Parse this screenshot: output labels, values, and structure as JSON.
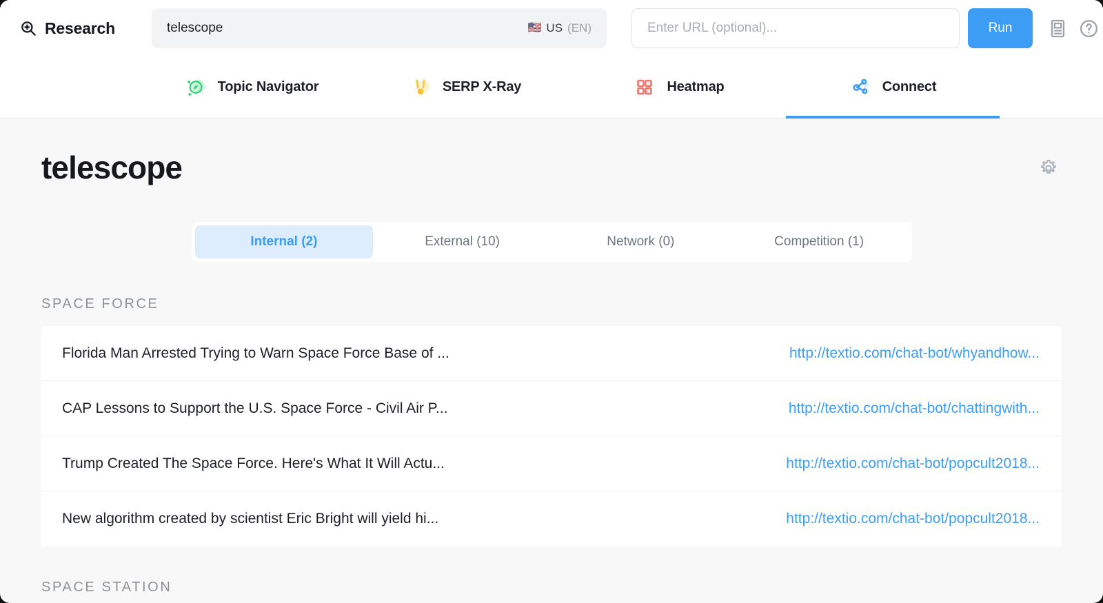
{
  "topbar": {
    "brand_icon": "zoom-in-magnifier-icon",
    "brand_name": "Research",
    "keyword_value": "telescope",
    "locale_flag": "🇺🇸",
    "locale_country": "US",
    "locale_language": "(EN)",
    "url_placeholder": "Enter URL (optional)...",
    "url_value": "",
    "run_label": "Run",
    "icons": [
      "article-icon",
      "help-circle-icon"
    ],
    "accent_color": "#3d9cf4"
  },
  "nav": {
    "tabs": [
      {
        "label": "Topic Navigator",
        "icon": "compass-icon",
        "color": "#2ecc71",
        "active": false
      },
      {
        "label": "SERP X-Ray",
        "icon": "medal-icon",
        "color": "#f5c53d",
        "active": false
      },
      {
        "label": "Heatmap",
        "icon": "grid-squares-icon",
        "color": "#f4736a",
        "active": false
      },
      {
        "label": "Connect",
        "icon": "node-graph-icon",
        "color": "#3d9cf4",
        "active": true
      }
    ]
  },
  "page": {
    "title": "telescope",
    "settings_icon": "gear-icon"
  },
  "segmented": {
    "items": [
      {
        "label": "Internal (2)",
        "active": true
      },
      {
        "label": "External (10)",
        "active": false
      },
      {
        "label": "Network (0)",
        "active": false
      },
      {
        "label": "Competition (1)",
        "active": false
      }
    ]
  },
  "groups": [
    {
      "title": "SPACE FORCE",
      "rows": [
        {
          "title": "Florida Man Arrested Trying to Warn Space Force Base of ...",
          "url": "http://textio.com/chat-bot/whyandhow..."
        },
        {
          "title": "CAP Lessons to Support the U.S. Space Force - Civil Air P...",
          "url": "http://textio.com/chat-bot/chattingwith..."
        },
        {
          "title": "Trump Created The Space Force. Here's What It Will Actu...",
          "url": "http://textio.com/chat-bot/popcult2018..."
        },
        {
          "title": "New algorithm created by scientist Eric Bright will yield hi...",
          "url": "http://textio.com/chat-bot/popcult2018..."
        }
      ]
    },
    {
      "title": "SPACE STATION",
      "rows": []
    }
  ]
}
